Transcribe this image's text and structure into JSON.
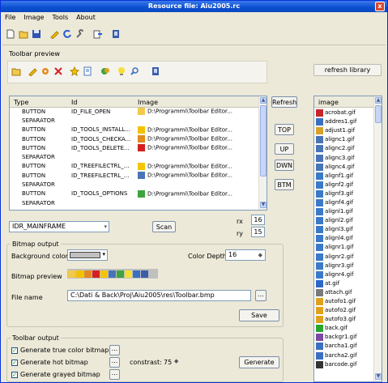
{
  "window": {
    "title": "Resource file: Aiu2005.rc",
    "close_label": "x"
  },
  "menu": [
    "File",
    "Image",
    "Tools",
    "About"
  ],
  "toolbar_icons": [
    "new-icon",
    "open-icon",
    "save-icon",
    "pencil-icon",
    "refresh-icon",
    "wrench-icon",
    "export-icon",
    "book-icon"
  ],
  "toolbar_preview": {
    "label": "Toolbar preview",
    "refresh_library": "refresh library",
    "icons": [
      "open-icon",
      "pencil-icon",
      "tools-icon",
      "delete-icon",
      "star-icon",
      "page-icon",
      "options-icon",
      "lightbulb-icon",
      "search-icon",
      "book-icon"
    ]
  },
  "list": {
    "columns": [
      "Type",
      "Id",
      "Image"
    ],
    "rows": [
      {
        "type": "BUTTON",
        "id": "ID_FILE_OPEN",
        "image": "D:\\Programmi\\Toolbar Editor...",
        "icon": "open-icon"
      },
      {
        "type": "SEPARATOR",
        "id": "",
        "image": "",
        "icon": ""
      },
      {
        "type": "BUTTON",
        "id": "ID_TOOLS_INSTALL...",
        "image": "D:\\Programmi\\Toolbar Editor...",
        "icon": "pencil-icon"
      },
      {
        "type": "BUTTON",
        "id": "ID_TOOLS_CHECKA...",
        "image": "D:\\Programmi\\Toolbar Editor...",
        "icon": "tools-icon"
      },
      {
        "type": "BUTTON",
        "id": "ID_TOOLS_DELETE...",
        "image": "D:\\Programmi\\Toolbar Editor...",
        "icon": "delete-icon"
      },
      {
        "type": "SEPARATOR",
        "id": "",
        "image": "",
        "icon": ""
      },
      {
        "type": "BUTTON",
        "id": "ID_TREEFILECTRL_...",
        "image": "D:\\Programmi\\Toolbar Editor...",
        "icon": "star-icon"
      },
      {
        "type": "BUTTON",
        "id": "ID_TREEFILECTRL_...",
        "image": "D:\\Programmi\\Toolbar Editor...",
        "icon": "page-icon"
      },
      {
        "type": "SEPARATOR",
        "id": "",
        "image": "",
        "icon": ""
      },
      {
        "type": "BUTTON",
        "id": "ID_TOOLS_OPTIONS",
        "image": "D:\\Programmi\\Toolbar Editor...",
        "icon": "options-icon"
      },
      {
        "type": "SEPARATOR",
        "id": "",
        "image": "",
        "icon": ""
      }
    ]
  },
  "side_buttons": {
    "refresh": "Refresh",
    "top": "TOP",
    "up": "UP",
    "down": "DWN",
    "bottom": "BTM"
  },
  "resource": {
    "value": "IDR_MAINFRAME",
    "scan": "Scan",
    "rx_label": "rx",
    "rx": "16",
    "ry_label": "ry",
    "ry": "15"
  },
  "bitmap_output": {
    "title": "Bitmap output",
    "bg_label": "Background color",
    "depth_label": "Color Depth",
    "depth": "16",
    "preview_label": "Bitmap preview",
    "file_label": "File name",
    "file": "C:\\Dati & Back\\Proj\\Aiu2005\\res\\Toolbar.bmp",
    "browse": "...",
    "save": "Save"
  },
  "toolbar_output": {
    "title": "Toolbar output",
    "options": [
      {
        "label": "Generate true color bitmap",
        "checked": true
      },
      {
        "label": "Generate hot bitmap",
        "checked": true
      },
      {
        "label": "Generate grayed bitmap",
        "checked": true
      }
    ],
    "browse": "...",
    "constrast_label": "constrast:",
    "constrast": "75",
    "generate": "Generate"
  },
  "library": {
    "header": "image",
    "items": [
      "acrobat.gif",
      "addres1.gif",
      "adjust1.gif",
      "alignc1.gif",
      "alignc2.gif",
      "alignc3.gif",
      "alignc4.gif",
      "alignf1.gif",
      "alignf2.gif",
      "alignf3.gif",
      "alignf4.gif",
      "alignl1.gif",
      "alignl2.gif",
      "alignl3.gif",
      "alignl4.gif",
      "alignr1.gif",
      "alignr2.gif",
      "alignr3.gif",
      "alignr4.gif",
      "at.gif",
      "attach.gif",
      "autofo1.gif",
      "autofo2.gif",
      "autofo3.gif",
      "back.gif",
      "backgr1.gif",
      "barcha1.gif",
      "barcha2.gif",
      "barcode.gif"
    ],
    "colors": [
      "#c8252b",
      "#3b6fc0",
      "#d6a228",
      "#4a74b8",
      "#4a74b8",
      "#4a74b8",
      "#4a74b8",
      "#3b79c9",
      "#3b79c9",
      "#3b79c9",
      "#3b79c9",
      "#3b79c9",
      "#3b79c9",
      "#3b79c9",
      "#3b79c9",
      "#3b79c9",
      "#3b79c9",
      "#3b79c9",
      "#3b79c9",
      "#2c67c8",
      "#7a7a7a",
      "#e0a11b",
      "#e0a11b",
      "#e0a11b",
      "#2aa52e",
      "#7c4aa0",
      "#3b6fc0",
      "#3b6fc0",
      "#333333"
    ]
  }
}
